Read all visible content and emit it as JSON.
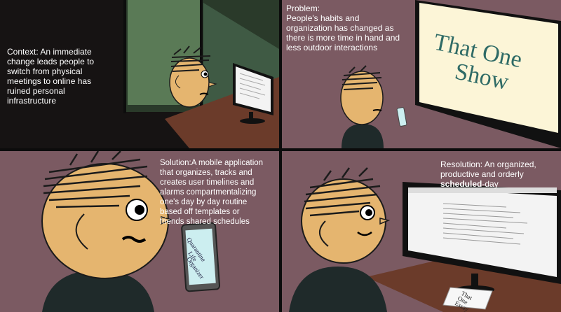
{
  "panels": [
    {
      "id": "context",
      "caption": "Context: An immediate\nchange leads people to\nswitch from physical\nmeetings to online has\nruined personal\ninfrastructure"
    },
    {
      "id": "problem",
      "caption": "Problem:\nPeople's habits and\norganization has changed as\nthere is more time in hand and\nless outdoor interactions",
      "poster_line1": "That One",
      "poster_line2": "Show"
    },
    {
      "id": "solution",
      "caption": "Solution:A mobile application\nthat organizes, tracks and\ncreates user timelines and\nalarms compartmentalizing\none's day by day routine\nbased off templates or\nfriends shared schedules",
      "phone_line1": "Quarantine",
      "phone_line2": "Life",
      "phone_line3": "Organizer"
    },
    {
      "id": "resolution",
      "caption_part1": "Resolution: An organized,\nproductive and orderly\n",
      "caption_bold": "scheduled",
      "caption_part2": "-day",
      "paper_line1": "That",
      "paper_line2": "One",
      "paper_line3": "Essay"
    }
  ],
  "colors": {
    "wall": "#7b5a62",
    "dark_room": "#161313",
    "window_green": "#5a7a56",
    "skin": "#e5b56f",
    "shirt": "#1f2a2a",
    "desk": "#6b3b2a",
    "poster_bg": "#fcf5d7",
    "poster_text": "#2f6b66",
    "phone_screen": "#cceef0"
  }
}
